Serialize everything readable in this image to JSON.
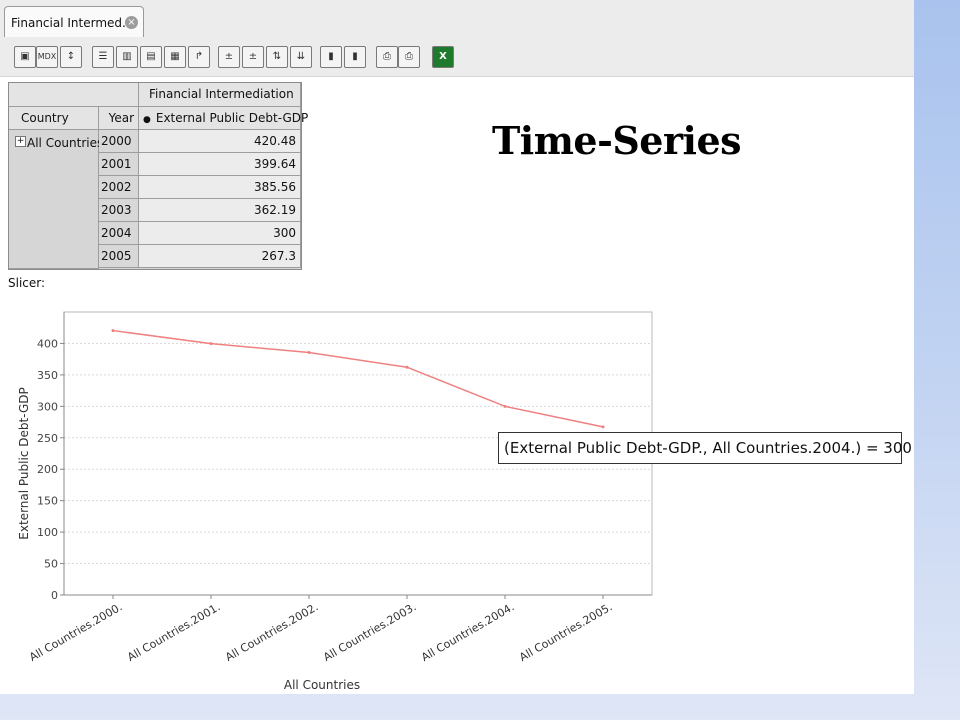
{
  "tab": {
    "label": "Financial Intermed..",
    "close_icon": "close-icon"
  },
  "toolbar": {
    "buttons": [
      {
        "name": "cube-navigator-button",
        "icon": "cube-icon"
      },
      {
        "name": "mdx-button",
        "label": "MDX",
        "icon": "mdx-icon"
      },
      {
        "name": "sort-button",
        "icon": "sort-az-icon"
      },
      {
        "name": "show-parent-button",
        "icon": "hierarchy-icon"
      },
      {
        "name": "hide-spans-button",
        "icon": "spans-icon"
      },
      {
        "name": "show-properties-button",
        "icon": "properties-icon"
      },
      {
        "name": "suppress-empty-button",
        "icon": "empty-rows-icon"
      },
      {
        "name": "swap-axes-button",
        "icon": "swap-axes-icon"
      },
      {
        "name": "drill-member-button",
        "icon": "drill-member-icon"
      },
      {
        "name": "drill-position-button",
        "icon": "drill-position-icon"
      },
      {
        "name": "drill-replace-button",
        "icon": "drill-replace-icon"
      },
      {
        "name": "drill-through-button",
        "icon": "drill-through-icon"
      },
      {
        "name": "show-chart-button",
        "icon": "bar-chart-icon"
      },
      {
        "name": "chart-config-button",
        "icon": "chart-config-icon"
      },
      {
        "name": "print-config-button",
        "icon": "print-config-icon"
      },
      {
        "name": "print-pdf-button",
        "icon": "print-icon"
      },
      {
        "name": "excel-export-button",
        "icon": "excel-icon",
        "color": "#1f7a2e"
      }
    ]
  },
  "pivot": {
    "group_header": "Financial Intermediation",
    "col_country": "Country",
    "col_year": "Year",
    "measure": "External Public Debt-GDP",
    "member": "All Countries",
    "rows": [
      {
        "year": "2000",
        "value": "420.48"
      },
      {
        "year": "2001",
        "value": "399.64"
      },
      {
        "year": "2002",
        "value": "385.56"
      },
      {
        "year": "2003",
        "value": "362.19"
      },
      {
        "year": "2004",
        "value": "300"
      },
      {
        "year": "2005",
        "value": "267.3"
      }
    ]
  },
  "slicer_label": "Slicer:",
  "title": "Time-Series",
  "tooltip": "(External Public Debt-GDP., All Countries.2004.) = 300",
  "chart_data": {
    "type": "line",
    "categories": [
      "All Countries.2000.",
      "All Countries.2001.",
      "All Countries.2002.",
      "All Countries.2003.",
      "All Countries.2004.",
      "All Countries.2005."
    ],
    "series": [
      {
        "name": "External Public Debt-GDP",
        "values": [
          420.48,
          399.64,
          385.56,
          362.19,
          300,
          267.3
        ],
        "color": "#f08080"
      }
    ],
    "xlabel": "All Countries",
    "ylabel": "External Public Debt-GDP",
    "ylim": [
      0,
      450
    ],
    "yticks": [
      0,
      50,
      100,
      150,
      200,
      250,
      300,
      350,
      400
    ],
    "grid": true
  }
}
